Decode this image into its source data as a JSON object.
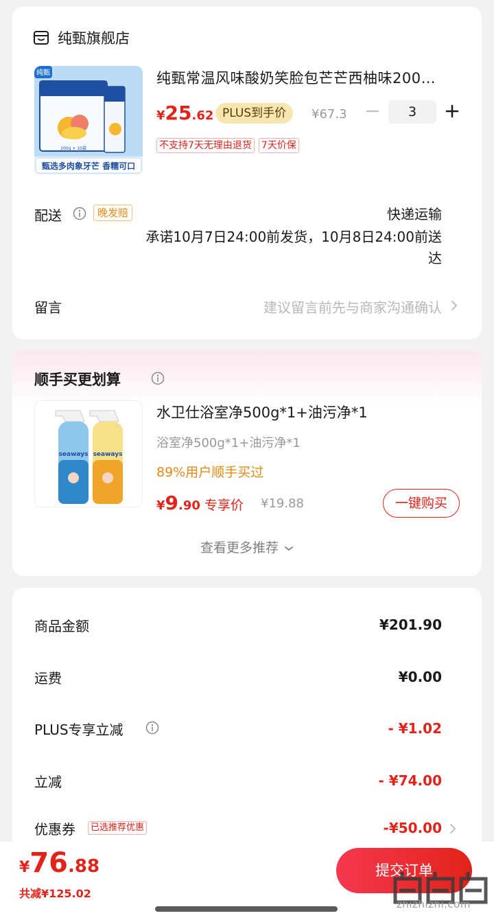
{
  "store": {
    "name": "纯甄旗舰店",
    "product": {
      "title": "纯甄常温风味酸奶笑脸包芒芒西柚味200…",
      "price_symbol": "¥",
      "price_int": "25",
      "price_dec": ".62",
      "plus_tag": "PLUS到手价",
      "original_price": "¥67.3",
      "quantity": "3",
      "service_tags": [
        "不支持7天无理由退货",
        "7天价保"
      ],
      "image_text": {
        "brand": "纯甄",
        "box_spec": "200g × 10袋",
        "banner": "甄选多肉象牙芒 香糯可口"
      }
    },
    "delivery": {
      "label": "配送",
      "late_tag": "晚发赔",
      "method": "快递运输",
      "promise": "承诺10月7日24:00前发货，10月8日24:00前送达"
    },
    "message": {
      "label": "留言",
      "placeholder": "建议留言前先与商家沟通确认"
    }
  },
  "bundle": {
    "title": "顺手买更划算",
    "name": "水卫仕浴室净500g*1+油污净*1",
    "subtitle": "浴室净500g*1+油污净*1",
    "social_proof": "89%用户顺手买过",
    "price_symbol": "¥",
    "price_int": "9",
    "price_dec": ".90",
    "exclusive_label": "专享价",
    "original_price": "¥19.88",
    "buy_button": "一键购买",
    "see_more": "查看更多推荐",
    "image_text": {
      "brand": "seaways"
    }
  },
  "summary": {
    "rows": [
      {
        "label": "商品金额",
        "value": "¥201.90"
      },
      {
        "label": "运费",
        "value": "¥0.00"
      },
      {
        "label": "PLUS专享立减",
        "value": "- ¥1.02"
      },
      {
        "label": "立减",
        "value": "- ¥74.00"
      },
      {
        "label": "优惠券",
        "value": "-¥50.00",
        "tag": "已选推荐优惠"
      }
    ]
  },
  "bottom": {
    "total_symbol": "¥",
    "total_int": "76",
    "total_dec": ".88",
    "total_discount": "共减¥125.02",
    "submit_button": "提交订单",
    "watermark": "值|值|值",
    "watermark_url": "zhizhizhi.com"
  },
  "colors": {
    "accent_red": "#e2231a",
    "orange": "#e48a16",
    "plus_gold": "#f8e6b0"
  }
}
